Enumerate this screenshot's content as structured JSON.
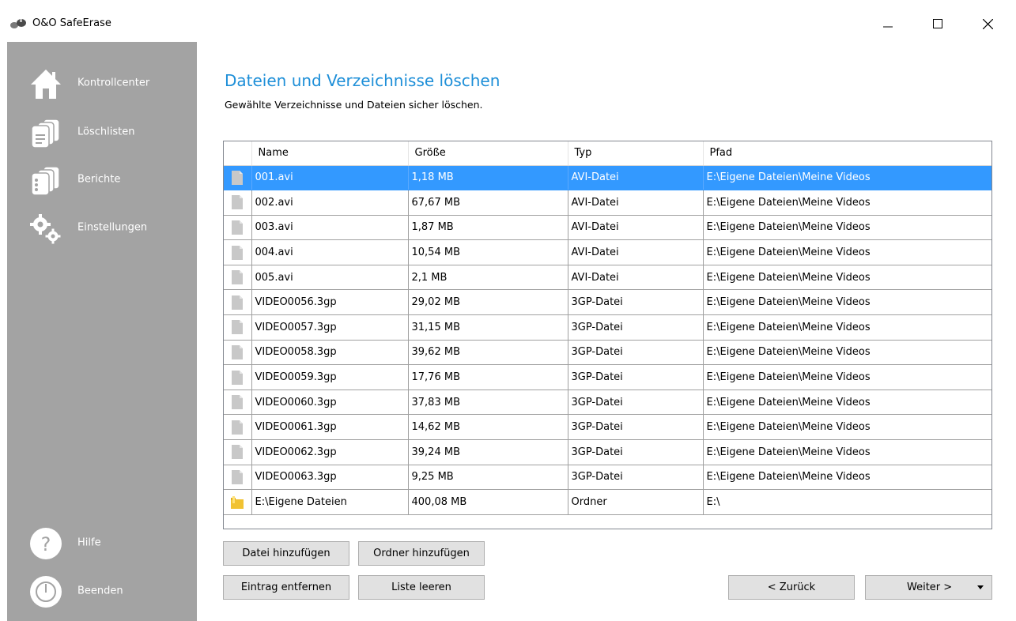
{
  "window": {
    "title": "O&O SafeErase",
    "icon": "app-logo-icon",
    "controls": [
      "minimize-icon",
      "maximize-icon",
      "close-icon"
    ]
  },
  "sidebar": {
    "background": "#a3a3a3",
    "items": [
      {
        "label": "Kontrollcenter",
        "icon": "home-icon"
      },
      {
        "label": "Löschlisten",
        "icon": "lists-icon"
      },
      {
        "label": "Berichte",
        "icon": "reports-icon"
      },
      {
        "label": "Einstellungen",
        "icon": "gears-icon"
      }
    ],
    "bottom_items": [
      {
        "label": "Hilfe",
        "icon": "help-icon"
      },
      {
        "label": "Beenden",
        "icon": "power-icon"
      }
    ]
  },
  "main": {
    "title": "Dateien und Verzeichnisse löschen",
    "title_color": "#1e8fd8",
    "subtitle": "Gewählte Verzeichnisse und Dateien sicher löschen.",
    "table": {
      "columns": [
        "Name",
        "Größe",
        "Typ",
        "Pfad"
      ],
      "selected_color": "#3399ff",
      "rows": [
        {
          "icon": "file-icon",
          "name": "001.avi",
          "size": "1,18 MB",
          "type": "AVI-Datei",
          "path": "E:\\Eigene Dateien\\Meine Videos",
          "selected": true
        },
        {
          "icon": "file-icon",
          "name": "002.avi",
          "size": "67,67 MB",
          "type": "AVI-Datei",
          "path": "E:\\Eigene Dateien\\Meine Videos"
        },
        {
          "icon": "file-icon",
          "name": "003.avi",
          "size": "1,87 MB",
          "type": "AVI-Datei",
          "path": "E:\\Eigene Dateien\\Meine Videos"
        },
        {
          "icon": "file-icon",
          "name": "004.avi",
          "size": "10,54 MB",
          "type": "AVI-Datei",
          "path": "E:\\Eigene Dateien\\Meine Videos"
        },
        {
          "icon": "file-icon",
          "name": "005.avi",
          "size": "2,1 MB",
          "type": "AVI-Datei",
          "path": "E:\\Eigene Dateien\\Meine Videos"
        },
        {
          "icon": "file-icon",
          "name": "VIDEO0056.3gp",
          "size": "29,02 MB",
          "type": "3GP-Datei",
          "path": "E:\\Eigene Dateien\\Meine Videos"
        },
        {
          "icon": "file-icon",
          "name": "VIDEO0057.3gp",
          "size": "31,15 MB",
          "type": "3GP-Datei",
          "path": "E:\\Eigene Dateien\\Meine Videos"
        },
        {
          "icon": "file-icon",
          "name": "VIDEO0058.3gp",
          "size": "39,62 MB",
          "type": "3GP-Datei",
          "path": "E:\\Eigene Dateien\\Meine Videos"
        },
        {
          "icon": "file-icon",
          "name": "VIDEO0059.3gp",
          "size": "17,76 MB",
          "type": "3GP-Datei",
          "path": "E:\\Eigene Dateien\\Meine Videos"
        },
        {
          "icon": "file-icon",
          "name": "VIDEO0060.3gp",
          "size": "37,83 MB",
          "type": "3GP-Datei",
          "path": "E:\\Eigene Dateien\\Meine Videos"
        },
        {
          "icon": "file-icon",
          "name": "VIDEO0061.3gp",
          "size": "14,62 MB",
          "type": "3GP-Datei",
          "path": "E:\\Eigene Dateien\\Meine Videos"
        },
        {
          "icon": "file-icon",
          "name": "VIDEO0062.3gp",
          "size": "39,24 MB",
          "type": "3GP-Datei",
          "path": "E:\\Eigene Dateien\\Meine Videos"
        },
        {
          "icon": "file-icon",
          "name": "VIDEO0063.3gp",
          "size": "9,25 MB",
          "type": "3GP-Datei",
          "path": "E:\\Eigene Dateien\\Meine Videos"
        },
        {
          "icon": "folder-icon",
          "name": "E:\\Eigene Dateien",
          "size": "400,08 MB",
          "type": "Ordner",
          "path": "E:\\"
        }
      ]
    },
    "buttons": {
      "add_file": "Datei hinzufügen",
      "add_folder": "Ordner hinzufügen",
      "remove_entry": "Eintrag entfernen",
      "clear_list": "Liste leeren",
      "back": "< Zurück",
      "next": "Weiter >"
    }
  }
}
